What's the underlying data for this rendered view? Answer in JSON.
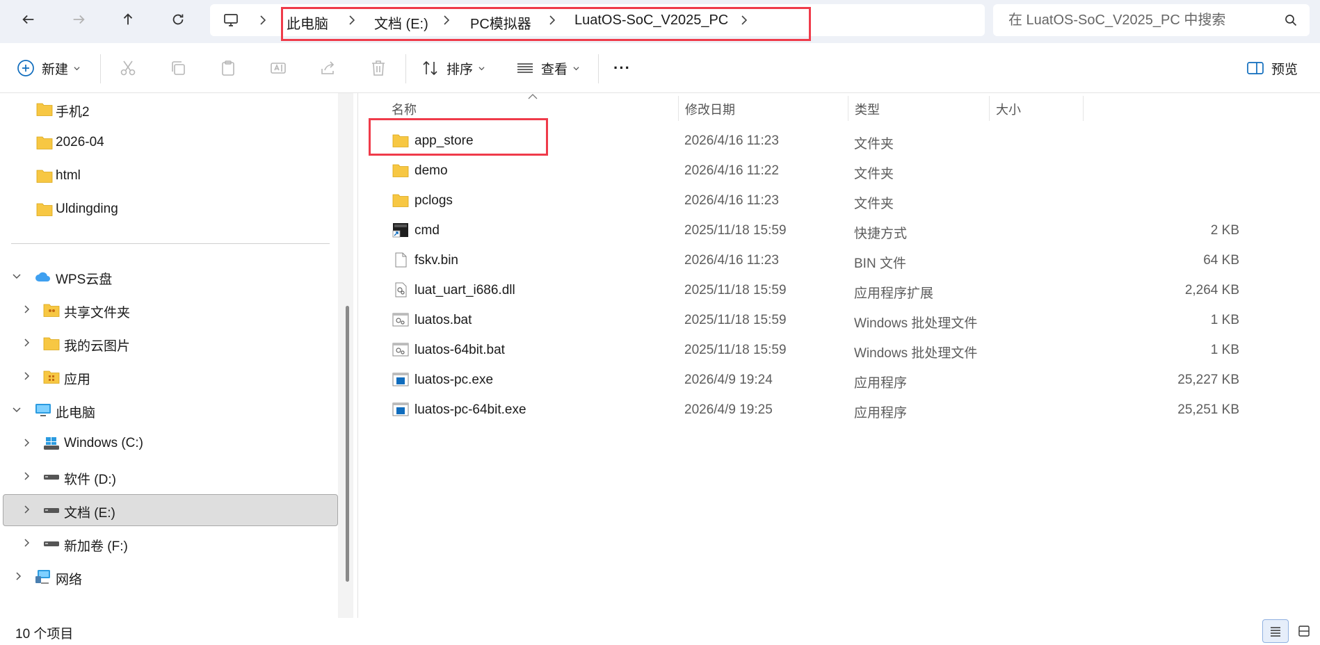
{
  "address": {
    "crumbs": [
      "此电脑",
      "文档 (E:)",
      "PC模拟器",
      "LuatOS-SoC_V2025_PC"
    ]
  },
  "search": {
    "placeholder": "在 LuatOS-SoC_V2025_PC 中搜索"
  },
  "toolbar": {
    "new_label": "新建",
    "sort_label": "排序",
    "view_label": "查看",
    "more_label": "···",
    "preview_label": "预览"
  },
  "nav": {
    "items": [
      {
        "label": "手机2",
        "icon": "folder-icon"
      },
      {
        "label": "2026-04",
        "icon": "folder-icon"
      },
      {
        "label": "html",
        "icon": "folder-icon"
      },
      {
        "label": "Uldingding",
        "icon": "folder-icon"
      },
      {
        "label": "WPS云盘",
        "icon": "cloud-icon"
      },
      {
        "label": "共享文件夹",
        "icon": "shared-folder-icon"
      },
      {
        "label": "我的云图片",
        "icon": "folder-icon"
      },
      {
        "label": "应用",
        "icon": "apps-folder-icon"
      },
      {
        "label": "此电脑",
        "icon": "this-pc-icon"
      },
      {
        "label": "Windows (C:)",
        "icon": "windows-drive-icon"
      },
      {
        "label": "软件 (D:)",
        "icon": "drive-icon"
      },
      {
        "label": "文档 (E:)",
        "icon": "drive-icon"
      },
      {
        "label": "新加卷 (F:)",
        "icon": "drive-icon"
      },
      {
        "label": "网络",
        "icon": "network-icon"
      }
    ]
  },
  "columns": {
    "name": "名称",
    "date": "修改日期",
    "type": "类型",
    "size": "大小"
  },
  "files": [
    {
      "name": "app_store",
      "date": "2026/4/16 11:23",
      "type": "文件夹",
      "size": "",
      "icon": "folder-icon"
    },
    {
      "name": "demo",
      "date": "2026/4/16 11:22",
      "type": "文件夹",
      "size": "",
      "icon": "folder-icon"
    },
    {
      "name": "pclogs",
      "date": "2026/4/16 11:23",
      "type": "文件夹",
      "size": "",
      "icon": "folder-icon"
    },
    {
      "name": "cmd",
      "date": "2025/11/18 15:59",
      "type": "快捷方式",
      "size": "2 KB",
      "icon": "shortcut-icon"
    },
    {
      "name": "fskv.bin",
      "date": "2026/4/16 11:23",
      "type": "BIN 文件",
      "size": "64 KB",
      "icon": "file-icon"
    },
    {
      "name": "luat_uart_i686.dll",
      "date": "2025/11/18 15:59",
      "type": "应用程序扩展",
      "size": "2,264 KB",
      "icon": "dll-icon"
    },
    {
      "name": "luatos.bat",
      "date": "2025/11/18 15:59",
      "type": "Windows 批处理文件",
      "size": "1 KB",
      "icon": "batch-file-icon"
    },
    {
      "name": "luatos-64bit.bat",
      "date": "2025/11/18 15:59",
      "type": "Windows 批处理文件",
      "size": "1 KB",
      "icon": "batch-file-icon"
    },
    {
      "name": "luatos-pc.exe",
      "date": "2026/4/9 19:24",
      "type": "应用程序",
      "size": "25,227 KB",
      "icon": "exe-icon"
    },
    {
      "name": "luatos-pc-64bit.exe",
      "date": "2026/4/9 19:25",
      "type": "应用程序",
      "size": "25,251 KB",
      "icon": "exe-icon"
    }
  ],
  "status": {
    "count": "10 个项目"
  },
  "colors": {
    "highlight": "#ef3b4a",
    "folder": "#f7c743",
    "accent": "#0f6cbd",
    "selected": "#dedede"
  }
}
